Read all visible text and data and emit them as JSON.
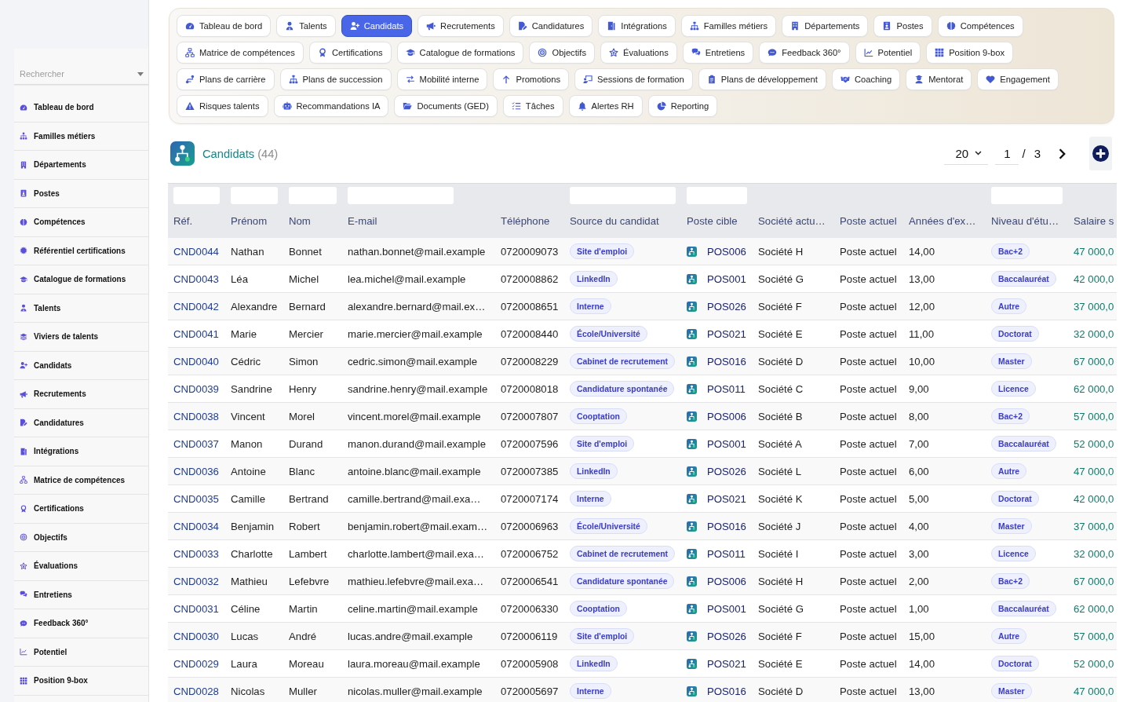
{
  "sidebar": {
    "search": {
      "placeholder": "Rechercher"
    },
    "items": [
      "Tableau de bord",
      "Familles métiers",
      "Départements",
      "Postes",
      "Compétences",
      "Référentiel certifications",
      "Catalogue de formations",
      "Talents",
      "Viviers de talents",
      "Candidats",
      "Recrutements",
      "Candidatures",
      "Intégrations",
      "Matrice de compétences",
      "Certifications",
      "Objectifs",
      "Évaluations",
      "Entretiens",
      "Feedback 360°",
      "Potentiel",
      "Position 9-box"
    ]
  },
  "tab_rows": [
    {
      "tabs": [
        {
          "label": "Tableau de bord",
          "selected": false
        },
        {
          "label": "Talents",
          "selected": false
        },
        {
          "label": "Candidats",
          "selected": true
        },
        {
          "label": "Recrutements",
          "selected": false
        },
        {
          "label": "Candidatures",
          "selected": false
        },
        {
          "label": "Intégrations",
          "selected": false
        },
        {
          "label": "Familles métiers",
          "selected": false
        },
        {
          "label": "Départements",
          "selected": false
        },
        {
          "label": "Postes",
          "selected": false
        },
        {
          "label": "Compétences",
          "selected": false
        }
      ]
    },
    {
      "tabs": [
        {
          "label": "Matrice de compétences",
          "selected": false
        },
        {
          "label": "Certifications",
          "selected": false
        },
        {
          "label": "Catalogue de formations",
          "selected": false
        },
        {
          "label": "Objectifs",
          "selected": false
        },
        {
          "label": "Évaluations",
          "selected": false
        },
        {
          "label": "Entretiens",
          "selected": false
        },
        {
          "label": "Feedback 360°",
          "selected": false
        },
        {
          "label": "Potentiel",
          "selected": false
        },
        {
          "label": "Position 9-box",
          "selected": false
        }
      ]
    },
    {
      "tabs": [
        {
          "label": "Plans de carrière",
          "selected": false
        },
        {
          "label": "Plans de succession",
          "selected": false
        },
        {
          "label": "Mobilité interne",
          "selected": false
        },
        {
          "label": "Promotions",
          "selected": false
        },
        {
          "label": "Sessions de formation",
          "selected": false
        },
        {
          "label": "Plans de développement",
          "selected": false
        },
        {
          "label": "Coaching",
          "selected": false
        },
        {
          "label": "Mentorat",
          "selected": false
        },
        {
          "label": "Engagement",
          "selected": false
        }
      ]
    },
    {
      "tabs": [
        {
          "label": "Risques talents",
          "selected": false
        },
        {
          "label": "Recommandations IA",
          "selected": false
        },
        {
          "label": "Documents (GED)",
          "selected": false
        },
        {
          "label": "Tâches",
          "selected": false
        },
        {
          "label": "Alertes RH",
          "selected": false
        },
        {
          "label": "Reporting",
          "selected": false
        }
      ]
    }
  ],
  "header": {
    "title": "Candidats",
    "count": "(44)"
  },
  "pagination": {
    "page_size": "20",
    "page": "1",
    "separator": "/",
    "total_pages": "3"
  },
  "table": {
    "columns": [
      {
        "label": "Réf.",
        "filter": true,
        "kind": "ref"
      },
      {
        "label": "Prénom",
        "filter": true,
        "kind": "text"
      },
      {
        "label": "Nom",
        "filter": true,
        "kind": "text"
      },
      {
        "label": "E-mail",
        "filter": true,
        "kind": "text"
      },
      {
        "label": "Téléphone",
        "filter": false,
        "kind": "text"
      },
      {
        "label": "Source du candidat",
        "filter": true,
        "kind": "badge"
      },
      {
        "label": "Poste cible",
        "filter": true,
        "kind": "position"
      },
      {
        "label": "Société actu…",
        "filter": false,
        "kind": "text"
      },
      {
        "label": "Poste actuel",
        "filter": false,
        "kind": "text"
      },
      {
        "label": "Années d'ex…",
        "filter": false,
        "kind": "text"
      },
      {
        "label": "Niveau d'étu…",
        "filter": true,
        "kind": "badge"
      },
      {
        "label": "Salaire s",
        "filter": false,
        "kind": "amount"
      }
    ],
    "rows": [
      {
        "cells": [
          "CND0044",
          "Nathan",
          "Bonnet",
          "nathan.bonnet@mail.example",
          "0720009073",
          "Site d'emploi",
          "POS006",
          "Société H",
          "Poste actuel",
          "14,00",
          "Bac+2",
          "47 000,0"
        ]
      },
      {
        "cells": [
          "CND0043",
          "Léa",
          "Michel",
          "lea.michel@mail.example",
          "0720008862",
          "LinkedIn",
          "POS001",
          "Société G",
          "Poste actuel",
          "13,00",
          "Baccalauréat",
          "42 000,0"
        ]
      },
      {
        "cells": [
          "CND0042",
          "Alexandre",
          "Bernard",
          "alexandre.bernard@mail.ex…",
          "0720008651",
          "Interne",
          "POS026",
          "Société F",
          "Poste actuel",
          "12,00",
          "Autre",
          "37 000,0"
        ]
      },
      {
        "cells": [
          "CND0041",
          "Marie",
          "Mercier",
          "marie.mercier@mail.example",
          "0720008440",
          "École/Université",
          "POS021",
          "Société E",
          "Poste actuel",
          "11,00",
          "Doctorat",
          "32 000,0"
        ]
      },
      {
        "cells": [
          "CND0040",
          "Cédric",
          "Simon",
          "cedric.simon@mail.example",
          "0720008229",
          "Cabinet de recrutement",
          "POS016",
          "Société D",
          "Poste actuel",
          "10,00",
          "Master",
          "67 000,0"
        ]
      },
      {
        "cells": [
          "CND0039",
          "Sandrine",
          "Henry",
          "sandrine.henry@mail.example",
          "0720008018",
          "Candidature spontanée",
          "POS011",
          "Société C",
          "Poste actuel",
          "9,00",
          "Licence",
          "62 000,0"
        ]
      },
      {
        "cells": [
          "CND0038",
          "Vincent",
          "Morel",
          "vincent.morel@mail.example",
          "0720007807",
          "Cooptation",
          "POS006",
          "Société B",
          "Poste actuel",
          "8,00",
          "Bac+2",
          "57 000,0"
        ]
      },
      {
        "cells": [
          "CND0037",
          "Manon",
          "Durand",
          "manon.durand@mail.example",
          "0720007596",
          "Site d'emploi",
          "POS001",
          "Société A",
          "Poste actuel",
          "7,00",
          "Baccalauréat",
          "52 000,0"
        ]
      },
      {
        "cells": [
          "CND0036",
          "Antoine",
          "Blanc",
          "antoine.blanc@mail.example",
          "0720007385",
          "LinkedIn",
          "POS026",
          "Société L",
          "Poste actuel",
          "6,00",
          "Autre",
          "47 000,0"
        ]
      },
      {
        "cells": [
          "CND0035",
          "Camille",
          "Bertrand",
          "camille.bertrand@mail.exa…",
          "0720007174",
          "Interne",
          "POS021",
          "Société K",
          "Poste actuel",
          "5,00",
          "Doctorat",
          "42 000,0"
        ]
      },
      {
        "cells": [
          "CND0034",
          "Benjamin",
          "Robert",
          "benjamin.robert@mail.exam…",
          "0720006963",
          "École/Université",
          "POS016",
          "Société J",
          "Poste actuel",
          "4,00",
          "Master",
          "37 000,0"
        ]
      },
      {
        "cells": [
          "CND0033",
          "Charlotte",
          "Lambert",
          "charlotte.lambert@mail.exa…",
          "0720006752",
          "Cabinet de recrutement",
          "POS011",
          "Société I",
          "Poste actuel",
          "3,00",
          "Licence",
          "32 000,0"
        ]
      },
      {
        "cells": [
          "CND0032",
          "Mathieu",
          "Lefebvre",
          "mathieu.lefebvre@mail.exa…",
          "0720006541",
          "Candidature spontanée",
          "POS006",
          "Société H",
          "Poste actuel",
          "2,00",
          "Bac+2",
          "67 000,0"
        ]
      },
      {
        "cells": [
          "CND0031",
          "Céline",
          "Martin",
          "celine.martin@mail.example",
          "0720006330",
          "Cooptation",
          "POS001",
          "Société G",
          "Poste actuel",
          "1,00",
          "Baccalauréat",
          "62 000,0"
        ]
      },
      {
        "cells": [
          "CND0030",
          "Lucas",
          "André",
          "lucas.andre@mail.example",
          "0720006119",
          "Site d'emploi",
          "POS026",
          "Société F",
          "Poste actuel",
          "15,00",
          "Autre",
          "57 000,0"
        ]
      },
      {
        "cells": [
          "CND0029",
          "Laura",
          "Moreau",
          "laura.moreau@mail.example",
          "0720005908",
          "LinkedIn",
          "POS021",
          "Société E",
          "Poste actuel",
          "14,00",
          "Doctorat",
          "52 000,0"
        ]
      },
      {
        "cells": [
          "CND0028",
          "Nicolas",
          "Muller",
          "nicolas.muller@mail.example",
          "0720005697",
          "Interne",
          "POS016",
          "Société D",
          "Poste actuel",
          "13,00",
          "Master",
          "47 000,0"
        ]
      }
    ]
  }
}
